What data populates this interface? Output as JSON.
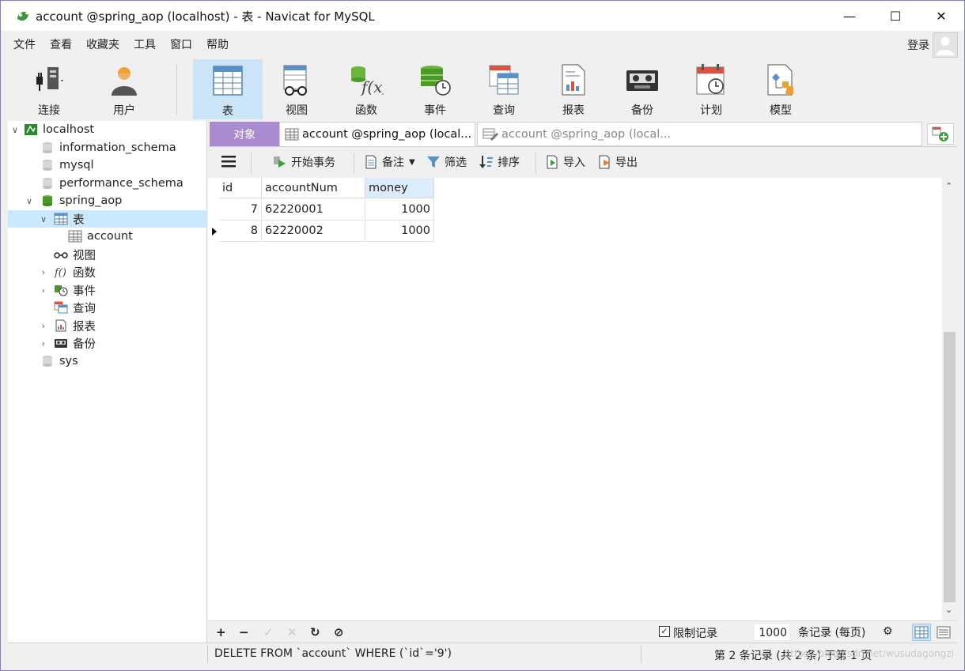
{
  "window": {
    "title": "account @spring_aop (localhost) - 表 - Navicat for MySQL",
    "minimize": "—",
    "maximize": "☐",
    "close": "✕"
  },
  "menu": [
    "文件",
    "查看",
    "收藏夹",
    "工具",
    "窗口",
    "帮助"
  ],
  "login_label": "登录",
  "toolbar": [
    {
      "label": "连接",
      "icon": "connection-icon"
    },
    {
      "label": "用户",
      "icon": "user-icon"
    },
    {
      "label": "表",
      "icon": "table-icon",
      "active": true
    },
    {
      "label": "视图",
      "icon": "view-icon"
    },
    {
      "label": "函数",
      "icon": "function-icon"
    },
    {
      "label": "事件",
      "icon": "event-icon"
    },
    {
      "label": "查询",
      "icon": "query-icon"
    },
    {
      "label": "报表",
      "icon": "report-icon"
    },
    {
      "label": "备份",
      "icon": "backup-icon"
    },
    {
      "label": "计划",
      "icon": "schedule-icon"
    },
    {
      "label": "模型",
      "icon": "model-icon"
    }
  ],
  "sidebar": {
    "connection": "localhost",
    "dbs": [
      "information_schema",
      "mysql",
      "performance_schema"
    ],
    "active_db": "spring_aop",
    "tables_node": "表",
    "table": "account",
    "views_node": "视图",
    "functions_node": "函数",
    "events_node": "事件",
    "queries_node": "查询",
    "reports_node": "报表",
    "backups_node": "备份",
    "last_db": "sys"
  },
  "tabs": {
    "objects": "对象",
    "tab1": "account @spring_aop (local...",
    "tab2": "account @spring_aop (local..."
  },
  "datatools": {
    "begin_tx": "开始事务",
    "memo": "备注",
    "filter": "筛选",
    "sort": "排序",
    "import": "导入",
    "export": "导出"
  },
  "grid": {
    "columns": [
      "id",
      "accountNum",
      "money"
    ],
    "rows": [
      {
        "id": "7",
        "accountNum": "62220001",
        "money": "1000"
      },
      {
        "id": "8",
        "accountNum": "62220002",
        "money": "1000"
      }
    ]
  },
  "gridbar": {
    "limit_checked": true,
    "limit_label": "限制记录",
    "limit_value": "1000",
    "per_page": "条记录 (每页)"
  },
  "status": {
    "sql": "DELETE FROM `account` WHERE (`id`='9')",
    "page_info": "第 2 条记录 (共 2 条) 于第 1 页",
    "watermark": "https://blog.csdn.net/wusudagongzi"
  },
  "colors": {
    "accent": "#cce4f7",
    "objects_tab": "#a98ccf",
    "selection": "#cce8ff"
  }
}
